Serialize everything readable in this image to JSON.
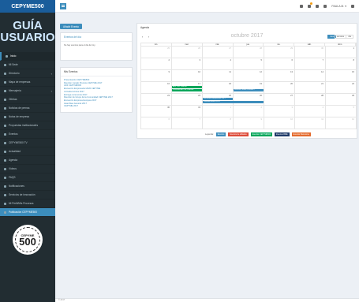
{
  "brand": "CEPYME500",
  "logo": {
    "line1": "GUÍA",
    "line2": "USUARIO"
  },
  "nav": [
    {
      "label": "Inicio",
      "active": true
    },
    {
      "label": "Mi Sede"
    },
    {
      "label": "Directorio",
      "arrow": true
    },
    {
      "label": "Mapa de empresas"
    },
    {
      "label": "Mensajería",
      "arrow": true
    },
    {
      "label": "Ofertas"
    },
    {
      "label": "Noticias de prensa"
    },
    {
      "label": "Notas de empresa"
    },
    {
      "label": "Propuestas institucionales"
    },
    {
      "label": "Eventos"
    },
    {
      "label": "CEPYME500 TV"
    },
    {
      "label": "Actualidad"
    },
    {
      "label": "Agenda"
    },
    {
      "label": "Vídeos"
    },
    {
      "label": "FAQS"
    },
    {
      "label": "Notificaciones"
    },
    {
      "label": "Servicios de innovación"
    },
    {
      "label": "Mi Perfil/Mis Procesos"
    },
    {
      "label": "Publicación CEPYME500",
      "highlight": true
    }
  ],
  "badge": {
    "top": "CEPYME",
    "number": "500"
  },
  "topbar": {
    "user": "PAULA M. ▾"
  },
  "add_event_label": "Añadir Evento",
  "events_box": {
    "title": "Eventos del día",
    "body": "No hay eventos para el día de hoy."
  },
  "mine_box": {
    "title": "Mis Eventos",
    "items": [
      "Presentación CEPYME500",
      "Reunión Jurado Premios CEPYME 2017",
      "ADF CEPYME500",
      "Encuentro Empresarial 2020 CEPYME",
      "Jornada técnica 2017",
      "Entrega ceremonia 2017",
      "Reunión de Grupo de la Comunidad CEPYME 2017",
      "Encuentro Empresa Europea 2017",
      "Asamblea General 2017",
      "CEPYME 2017"
    ]
  },
  "agenda": {
    "title": "Agenda",
    "prev": "‹",
    "next": "›",
    "month": "octubre 2017",
    "views": [
      "mes",
      "semana",
      "día"
    ],
    "weekdays": [
      "lun.",
      "mar.",
      "mié.",
      "jue.",
      "vie.",
      "sáb.",
      "dom."
    ],
    "weeks": [
      [
        "25",
        "26",
        "27",
        "28",
        "29",
        "30",
        "1"
      ],
      [
        "2",
        "3",
        "4",
        "5",
        "6",
        "7",
        "8"
      ],
      [
        "9",
        "10",
        "11",
        "12",
        "13",
        "14",
        "15"
      ],
      [
        "16",
        "17",
        "18",
        "19",
        "20",
        "21",
        "22"
      ],
      [
        "23",
        "24",
        "25",
        "26",
        "27",
        "28",
        "29"
      ],
      [
        "30",
        "31",
        "1",
        "2",
        "3",
        "4",
        "5"
      ],
      [
        "6",
        "7",
        "8",
        "9",
        "10",
        "11",
        "12"
      ]
    ],
    "events": [
      {
        "label": "ADF CEPYME500",
        "week": 3,
        "day": 1,
        "span": 1,
        "row": 0,
        "color": "#00a65a"
      },
      {
        "label": "Presentación CEPYME500",
        "week": 3,
        "day": 1,
        "span": 1,
        "row": 1,
        "color": "#00a65a"
      },
      {
        "label": "Reunión Jurado Premios C",
        "week": 3,
        "day": 3,
        "span": 1,
        "row": 1,
        "color": "#3c8dbc"
      },
      {
        "label": "Encuentro Empresarial 2017",
        "week": 4,
        "day": 2,
        "span": 1,
        "row": 0,
        "color": "#3c8dbc"
      },
      {
        "label": "Jornada técnica 2017",
        "week": 4,
        "day": 2,
        "span": 2,
        "row": 1,
        "color": "#3c8dbc"
      }
    ]
  },
  "legend": {
    "label": "Leyenda:",
    "items": [
      {
        "label": "Eventos",
        "color": "#3c8dbc"
      },
      {
        "label": "Eventos de afiliados",
        "color": "#dd4b39"
      },
      {
        "label": "Eventos CEPYME500",
        "color": "#00a65a"
      },
      {
        "label": "Eventos BME",
        "color": "#1f3a68"
      },
      {
        "label": "Eventos Barcelona",
        "color": "#e46b2e"
      }
    ]
  },
  "footer": "© 2017"
}
